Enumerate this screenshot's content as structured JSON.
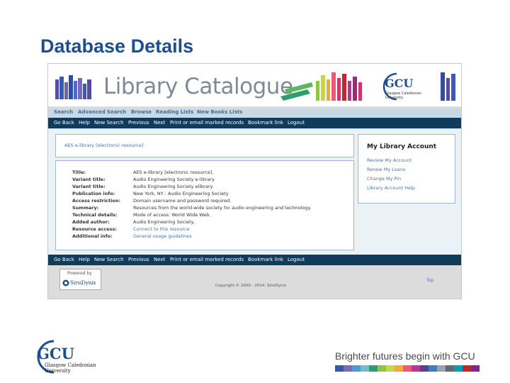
{
  "slide": {
    "title": "Database Details",
    "tagline": "Brighter futures begin with GCU"
  },
  "catalogue": {
    "banner_title": "Library Catalogue",
    "top_nav": [
      "Search",
      "Advanced Search",
      "Browse",
      "Reading Lists",
      "New Books Lists"
    ],
    "action_bar": [
      "Go Back",
      "Help",
      "New Search",
      "Previous",
      "Next",
      "Print or email marked records",
      "Bookmark link",
      "Logout"
    ],
    "record_heading": "AES e-library [electronic resource]",
    "details": [
      {
        "label": "Title:",
        "value": "AES e-library [electronic resource]."
      },
      {
        "label": "Variant title:",
        "value": "Audio Engineering Society e-library"
      },
      {
        "label": "Variant title:",
        "value": "Audio Engineering Society elibrary"
      },
      {
        "label": "Publication info:",
        "value": "New York, NY : Audio Engineering Society"
      },
      {
        "label": "Access restriction:",
        "value": "Domain username and password required."
      },
      {
        "label": "Summary:",
        "value": "Resources from the world-wide society for audio engineering and technology."
      },
      {
        "label": "Technical details:",
        "value": "Mode of access: World Wide Web."
      },
      {
        "label": "Added author:",
        "value": "Audio Engineering Society."
      },
      {
        "label": "Resource access:",
        "value": "Connect to this resource"
      },
      {
        "label": "Additional info:",
        "value": "General usage guidelines"
      }
    ],
    "account": {
      "heading": "My Library Account",
      "links": [
        "Review My Account",
        "Renew My Loans",
        "Change My Pin",
        "Library Account Help"
      ]
    },
    "powered_by": "Powered by",
    "sirsi": "SirsiDynix",
    "copyright": "Copyright © 2000 - 2014. SirsiDynix",
    "top_link": "Top"
  },
  "logo": {
    "acronym": "GCU",
    "name_line1": "Glasgow Caledonian",
    "name_line2": "University"
  },
  "colors": {
    "title_blue": "#1f4e8f",
    "nav_dark": "#123b5a",
    "link_blue": "#4a73a8",
    "bottom_bar": [
      "#3a57a6",
      "#7b6bb2",
      "#4b9cd3",
      "#6ec1c4",
      "#2f9e6f",
      "#8dc63f",
      "#c7d64a",
      "#f0a93b",
      "#e85d75",
      "#b6378f",
      "#5a3f8f",
      "#3a7fc1",
      "#9aa3ad",
      "#5d6b78",
      "#00a0b0",
      "#c1272d",
      "#7a2a8a"
    ]
  }
}
